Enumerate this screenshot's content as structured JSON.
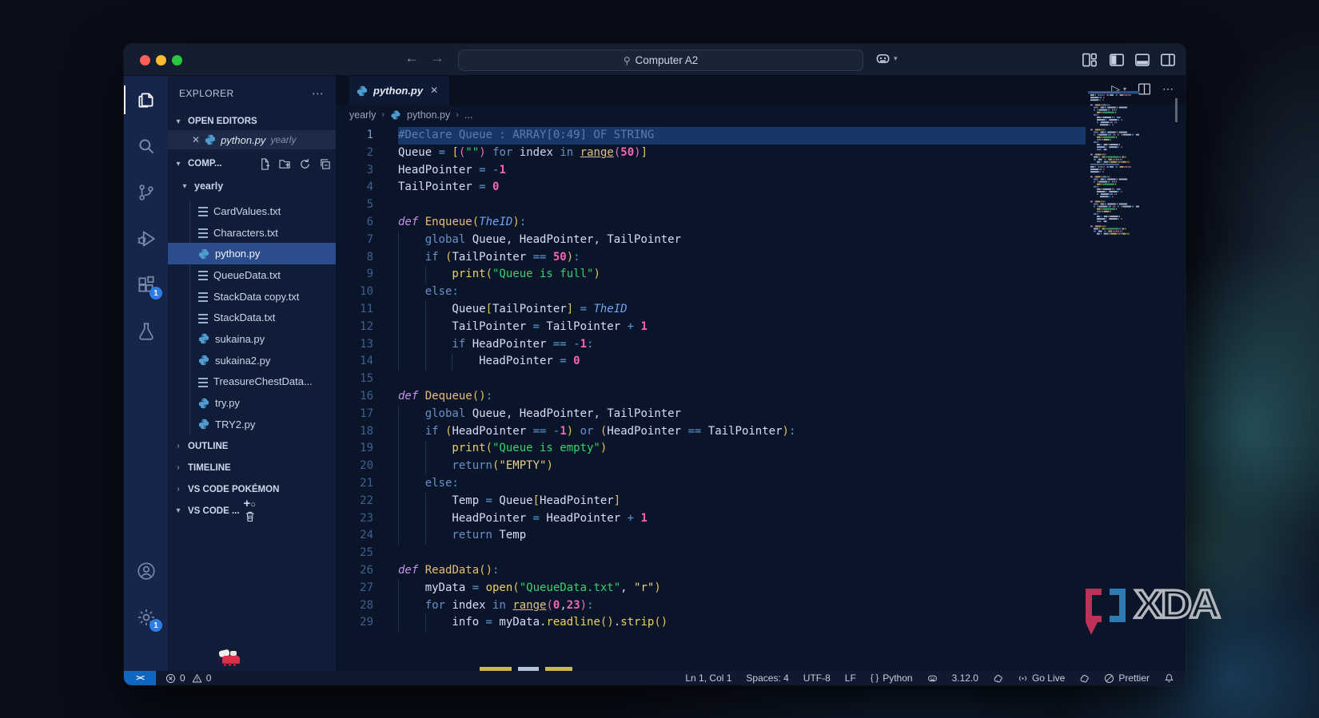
{
  "titlebar": {
    "search_value": "Computer A2"
  },
  "activity_bar": {
    "extensions_badge": "1",
    "settings_badge": "1"
  },
  "sidebar": {
    "explorer_title": "EXPLORER",
    "open_editors_label": "OPEN EDITORS",
    "workspace_label": "COMP...",
    "open_editor": {
      "name": "python.py",
      "folder": "yearly"
    },
    "folder_label": "yearly",
    "files": [
      {
        "name": "CardValues.txt",
        "type": "txt"
      },
      {
        "name": "Characters.txt",
        "type": "txt"
      },
      {
        "name": "python.py",
        "type": "py",
        "selected": true
      },
      {
        "name": "QueueData.txt",
        "type": "txt"
      },
      {
        "name": "StackData copy.txt",
        "type": "txt"
      },
      {
        "name": "StackData.txt",
        "type": "txt"
      },
      {
        "name": "sukaina.py",
        "type": "py"
      },
      {
        "name": "sukaina2.py",
        "type": "py"
      },
      {
        "name": "TreasureChestData...",
        "type": "txt"
      },
      {
        "name": "try.py",
        "type": "py"
      },
      {
        "name": "TRY2.py",
        "type": "py"
      }
    ],
    "bottom_sections": [
      {
        "label": "OUTLINE",
        "expanded": false
      },
      {
        "label": "TIMELINE",
        "expanded": false
      },
      {
        "label": "VS CODE POKÉMON",
        "expanded": false
      },
      {
        "label": "VS CODE ...",
        "expanded": true,
        "has_actions": true
      }
    ]
  },
  "editor": {
    "tab_label": "python.py",
    "breadcrumbs": [
      "yearly",
      "python.py",
      "..."
    ],
    "code": {
      "lines": [
        {
          "n": 1,
          "ind": 0,
          "sel": true,
          "tk": [
            [
              "com",
              "#Declare Queue : ARRAY[0:49] OF STRING"
            ]
          ]
        },
        {
          "n": 2,
          "ind": 0,
          "tk": [
            [
              "v",
              "Queue"
            ],
            [
              "op",
              " = "
            ],
            [
              "br",
              "["
            ],
            [
              "br2",
              "("
            ],
            [
              "str",
              "\"\""
            ],
            [
              "br2",
              ")"
            ],
            [
              "t",
              " "
            ],
            [
              "kw2",
              "for"
            ],
            [
              "t",
              " index "
            ],
            [
              "kw2",
              "in"
            ],
            [
              "t",
              " "
            ],
            [
              "link",
              "range"
            ],
            [
              "br2",
              "("
            ],
            [
              "num",
              "50"
            ],
            [
              "br2",
              ")"
            ],
            [
              "br",
              "]"
            ]
          ]
        },
        {
          "n": 3,
          "ind": 0,
          "tk": [
            [
              "v",
              "HeadPointer"
            ],
            [
              "op",
              " = -"
            ],
            [
              "num",
              "1"
            ]
          ]
        },
        {
          "n": 4,
          "ind": 0,
          "tk": [
            [
              "v",
              "TailPointer"
            ],
            [
              "op",
              " = "
            ],
            [
              "num",
              "0"
            ]
          ]
        },
        {
          "n": 5,
          "ind": 0,
          "tk": []
        },
        {
          "n": 6,
          "ind": 0,
          "tk": [
            [
              "kw",
              "def"
            ],
            [
              "t",
              " "
            ],
            [
              "fn",
              "Enqueue"
            ],
            [
              "br",
              "("
            ],
            [
              "param",
              "TheID"
            ],
            [
              "br",
              ")"
            ],
            [
              "op",
              ":"
            ]
          ]
        },
        {
          "n": 7,
          "ind": 1,
          "tk": [
            [
              "kw2",
              "global"
            ],
            [
              "t",
              " "
            ],
            [
              "v",
              "Queue"
            ],
            [
              "t",
              ", "
            ],
            [
              "v",
              "HeadPointer"
            ],
            [
              "t",
              ", "
            ],
            [
              "v",
              "TailPointer"
            ]
          ]
        },
        {
          "n": 8,
          "ind": 1,
          "tk": [
            [
              "kw2",
              "if"
            ],
            [
              "t",
              " "
            ],
            [
              "br",
              "("
            ],
            [
              "v",
              "TailPointer"
            ],
            [
              "op",
              " == "
            ],
            [
              "num",
              "50"
            ],
            [
              "br",
              ")"
            ],
            [
              "op",
              ":"
            ]
          ]
        },
        {
          "n": 9,
          "ind": 2,
          "tk": [
            [
              "call",
              "print"
            ],
            [
              "br",
              "("
            ],
            [
              "str",
              "\"Queue is full\""
            ],
            [
              "br",
              ")"
            ]
          ]
        },
        {
          "n": 10,
          "ind": 1,
          "tk": [
            [
              "kw2",
              "else"
            ],
            [
              "op",
              ":"
            ]
          ]
        },
        {
          "n": 11,
          "ind": 2,
          "tk": [
            [
              "v",
              "Queue"
            ],
            [
              "br",
              "["
            ],
            [
              "v",
              "TailPointer"
            ],
            [
              "br",
              "]"
            ],
            [
              "op",
              " = "
            ],
            [
              "param",
              "TheID"
            ]
          ]
        },
        {
          "n": 12,
          "ind": 2,
          "tk": [
            [
              "v",
              "TailPointer"
            ],
            [
              "op",
              " = "
            ],
            [
              "v",
              "TailPointer"
            ],
            [
              "op",
              " + "
            ],
            [
              "num",
              "1"
            ]
          ]
        },
        {
          "n": 13,
          "ind": 2,
          "tk": [
            [
              "kw2",
              "if"
            ],
            [
              "t",
              " "
            ],
            [
              "v",
              "HeadPointer"
            ],
            [
              "op",
              " == -"
            ],
            [
              "num",
              "1"
            ],
            [
              "op",
              ":"
            ]
          ]
        },
        {
          "n": 14,
          "ind": 3,
          "tk": [
            [
              "v",
              "HeadPointer"
            ],
            [
              "op",
              " = "
            ],
            [
              "num",
              "0"
            ]
          ]
        },
        {
          "n": 15,
          "ind": 0,
          "tk": []
        },
        {
          "n": 16,
          "ind": 0,
          "tk": [
            [
              "kw",
              "def"
            ],
            [
              "t",
              " "
            ],
            [
              "fn",
              "Dequeue"
            ],
            [
              "br",
              "("
            ],
            [
              "br",
              ")"
            ],
            [
              "op",
              ":"
            ]
          ]
        },
        {
          "n": 17,
          "ind": 1,
          "tk": [
            [
              "kw2",
              "global"
            ],
            [
              "t",
              " "
            ],
            [
              "v",
              "Queue"
            ],
            [
              "t",
              ", "
            ],
            [
              "v",
              "HeadPointer"
            ],
            [
              "t",
              ", "
            ],
            [
              "v",
              "TailPointer"
            ]
          ]
        },
        {
          "n": 18,
          "ind": 1,
          "tk": [
            [
              "kw2",
              "if"
            ],
            [
              "t",
              " "
            ],
            [
              "br",
              "("
            ],
            [
              "v",
              "HeadPointer"
            ],
            [
              "op",
              " == -"
            ],
            [
              "num",
              "1"
            ],
            [
              "br",
              ")"
            ],
            [
              "t",
              " "
            ],
            [
              "kw2",
              "or"
            ],
            [
              "t",
              " "
            ],
            [
              "br",
              "("
            ],
            [
              "v",
              "HeadPointer"
            ],
            [
              "op",
              " == "
            ],
            [
              "v",
              "TailPointer"
            ],
            [
              "br",
              ")"
            ],
            [
              "op",
              ":"
            ]
          ]
        },
        {
          "n": 19,
          "ind": 2,
          "tk": [
            [
              "call",
              "print"
            ],
            [
              "br",
              "("
            ],
            [
              "str",
              "\"Queue is empty\""
            ],
            [
              "br",
              ")"
            ]
          ]
        },
        {
          "n": 20,
          "ind": 2,
          "tk": [
            [
              "kw2",
              "return"
            ],
            [
              "br",
              "("
            ],
            [
              "str2",
              "\"EMPTY\""
            ],
            [
              "br",
              ")"
            ]
          ]
        },
        {
          "n": 21,
          "ind": 1,
          "tk": [
            [
              "kw2",
              "else"
            ],
            [
              "op",
              ":"
            ]
          ]
        },
        {
          "n": 22,
          "ind": 2,
          "tk": [
            [
              "v",
              "Temp"
            ],
            [
              "op",
              " = "
            ],
            [
              "v",
              "Queue"
            ],
            [
              "br",
              "["
            ],
            [
              "v",
              "HeadPointer"
            ],
            [
              "br",
              "]"
            ]
          ]
        },
        {
          "n": 23,
          "ind": 2,
          "tk": [
            [
              "v",
              "HeadPointer"
            ],
            [
              "op",
              " = "
            ],
            [
              "v",
              "HeadPointer"
            ],
            [
              "op",
              " + "
            ],
            [
              "num",
              "1"
            ]
          ]
        },
        {
          "n": 24,
          "ind": 2,
          "tk": [
            [
              "kw2",
              "return"
            ],
            [
              "t",
              " "
            ],
            [
              "v",
              "Temp"
            ]
          ]
        },
        {
          "n": 25,
          "ind": 0,
          "tk": []
        },
        {
          "n": 26,
          "ind": 0,
          "tk": [
            [
              "kw",
              "def"
            ],
            [
              "t",
              " "
            ],
            [
              "fn",
              "ReadData"
            ],
            [
              "br",
              "("
            ],
            [
              "br",
              ")"
            ],
            [
              "op",
              ":"
            ]
          ]
        },
        {
          "n": 27,
          "ind": 1,
          "tk": [
            [
              "v",
              "myData"
            ],
            [
              "op",
              " = "
            ],
            [
              "call",
              "open"
            ],
            [
              "br",
              "("
            ],
            [
              "str",
              "\"QueueData.txt\""
            ],
            [
              "t",
              ", "
            ],
            [
              "str2",
              "\"r\""
            ],
            [
              "br",
              ")"
            ]
          ]
        },
        {
          "n": 28,
          "ind": 1,
          "tk": [
            [
              "kw2",
              "for"
            ],
            [
              "t",
              " "
            ],
            [
              "v",
              "index"
            ],
            [
              "t",
              " "
            ],
            [
              "kw2",
              "in"
            ],
            [
              "t",
              " "
            ],
            [
              "link",
              "range"
            ],
            [
              "br2",
              "("
            ],
            [
              "num",
              "0"
            ],
            [
              "t",
              ","
            ],
            [
              "num",
              "23"
            ],
            [
              "br2",
              ")"
            ],
            [
              "op",
              ":"
            ]
          ]
        },
        {
          "n": 29,
          "ind": 2,
          "tk": [
            [
              "v",
              "info"
            ],
            [
              "op",
              " = "
            ],
            [
              "v",
              "myData"
            ],
            [
              "t",
              "."
            ],
            [
              "call",
              "readline"
            ],
            [
              "br",
              "("
            ],
            [
              "br",
              ")"
            ],
            [
              "t",
              "."
            ],
            [
              "call",
              "strip"
            ],
            [
              "br",
              "("
            ],
            [
              "br",
              ")"
            ]
          ]
        }
      ]
    }
  },
  "status_bar": {
    "errors": "0",
    "warnings": "0",
    "line_col": "Ln 1, Col 1",
    "spaces": "Spaces: 4",
    "encoding": "UTF-8",
    "eol": "LF",
    "language": "Python",
    "braces": "{ }",
    "version": "3.12.0",
    "go_live": "Go Live",
    "prettier": "Prettier"
  },
  "watermark": {
    "text": "XDA"
  },
  "colors": {
    "editor_bg": "#0b1529",
    "sidebar_bg": "#101d38",
    "activity_bg": "#16254c",
    "titlebar_bg": "#151d31",
    "statusbar_bg": "#10192e",
    "remote_bg": "#1066c0",
    "selection": "#183768",
    "file_selected": "#2c4d8d",
    "badge": "#2e7de0",
    "accent_py_icon": "#4f9cd1"
  }
}
